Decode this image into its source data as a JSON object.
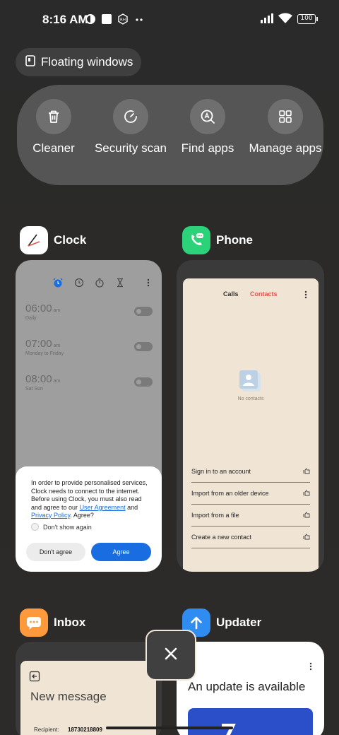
{
  "status_bar": {
    "time": "8:16 AM",
    "battery": "100",
    "icons_left": [
      "app-notification-icon",
      "square-notification-icon",
      "rh-notification-icon",
      "more-dots-icon"
    ],
    "icons_right": [
      "signal-icon",
      "wifi-icon",
      "battery-icon"
    ]
  },
  "floating_windows": {
    "label": "Floating windows",
    "icon": "floating-window-icon"
  },
  "actions": [
    {
      "label": "Cleaner",
      "icon": "trash-icon"
    },
    {
      "label": "Security scan",
      "icon": "security-scan-icon"
    },
    {
      "label": "Find apps",
      "icon": "find-apps-icon"
    },
    {
      "label": "Manage apps",
      "icon": "grid-icon"
    }
  ],
  "apps": {
    "clock": {
      "name": "Clock",
      "alarms": [
        {
          "time": "06:00",
          "ampm": "am",
          "sub": "Daily"
        },
        {
          "time": "07:00",
          "ampm": "am",
          "sub": "Monday to Friday"
        },
        {
          "time": "08:00",
          "ampm": "am",
          "sub": "Sat Sun"
        }
      ],
      "dialog": {
        "text_1": "In order to provide personalised services, Clock needs to connect to the internet. Before using Clock, you must also read and agree to our ",
        "link_1": "User Agreement",
        "text_2": " and ",
        "link_2": "Privacy Policy",
        "text_3": ". Agree?",
        "checkbox": "Don't show again",
        "disagree": "Don't agree",
        "agree": "Agree"
      }
    },
    "phone": {
      "name": "Phone",
      "tabs": [
        "Calls",
        "Contacts"
      ],
      "empty": "No contacts",
      "rows": [
        "Sign in to an account",
        "Import from an older device",
        "Import from a file",
        "Create a new contact"
      ]
    },
    "inbox": {
      "name": "Inbox",
      "title": "New message",
      "recipient_label": "Recipient:",
      "recipient_value": "18730218809"
    },
    "updater": {
      "name": "Updater",
      "title": "An update is available"
    }
  },
  "colors": {
    "clock_accent": "#1a6de0",
    "contacts_tab": "#e0554a",
    "phone_icon_bg": "#2bd27a",
    "inbox_icon_bg": "#ff9a3c",
    "updater_icon_bg": "#2f8cf0"
  }
}
